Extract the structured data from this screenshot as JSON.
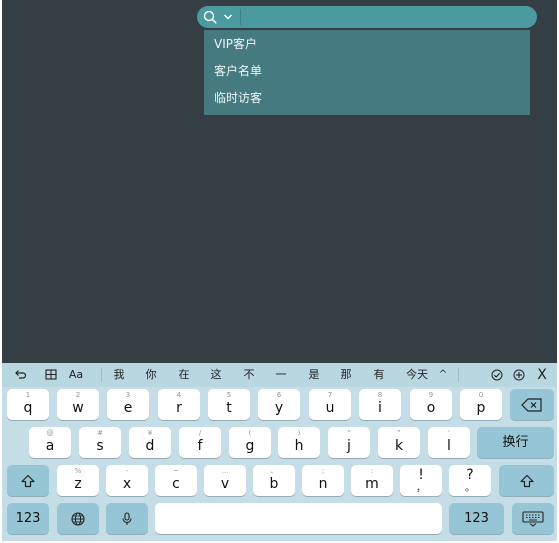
{
  "search": {
    "placeholder": "",
    "value": ""
  },
  "icons": {
    "search": "search-icon",
    "dropdown": "chevron-down-icon",
    "shift": "shift-icon",
    "backspace": "backspace-icon",
    "globe": "globe-icon",
    "mic": "microphone-icon",
    "keyboard_hide": "keyboard-hide-icon",
    "undo": "undo-icon",
    "table": "table-icon",
    "check": "check-circle-icon",
    "plus": "plus-circle-icon"
  },
  "dropdown": {
    "items": [
      "VIP客户",
      "客户名单",
      "临时访客"
    ]
  },
  "keyboard": {
    "toolbar": {
      "font_label": "Aa",
      "collapse": "^",
      "close": "X"
    },
    "candidates": [
      "我",
      "你",
      "在",
      "这",
      "不",
      "一",
      "是",
      "那",
      "有",
      "今天"
    ],
    "row1": [
      {
        "main": "q",
        "sub": "1"
      },
      {
        "main": "w",
        "sub": "2"
      },
      {
        "main": "e",
        "sub": "3"
      },
      {
        "main": "r",
        "sub": "4"
      },
      {
        "main": "t",
        "sub": "5"
      },
      {
        "main": "y",
        "sub": "6"
      },
      {
        "main": "u",
        "sub": "7"
      },
      {
        "main": "i",
        "sub": "8"
      },
      {
        "main": "o",
        "sub": "9"
      },
      {
        "main": "p",
        "sub": "0"
      }
    ],
    "row2": [
      {
        "main": "a",
        "sub": "@"
      },
      {
        "main": "s",
        "sub": "#"
      },
      {
        "main": "d",
        "sub": "¥"
      },
      {
        "main": "f",
        "sub": "/"
      },
      {
        "main": "g",
        "sub": "("
      },
      {
        "main": "h",
        "sub": ")"
      },
      {
        "main": "j",
        "sub": "“"
      },
      {
        "main": "k",
        "sub": "”"
      },
      {
        "main": "l",
        "sub": "'"
      }
    ],
    "row3": [
      {
        "main": "z",
        "sub": "%"
      },
      {
        "main": "x",
        "sub": "-"
      },
      {
        "main": "c",
        "sub": "~"
      },
      {
        "main": "v",
        "sub": "…"
      },
      {
        "main": "b",
        "sub": "、"
      },
      {
        "main": "n",
        "sub": ";"
      },
      {
        "main": "m",
        "sub": ":"
      },
      {
        "main": "!",
        "sub": "，"
      },
      {
        "main": "?",
        "sub": "。"
      }
    ],
    "enter_label": "换行",
    "numbers_label": "123",
    "space_label": ""
  },
  "colors": {
    "background": "#343e43",
    "accent": "#4a9aa0",
    "dropdown": "#447a80",
    "keyboard": "#c4dde6",
    "function_key": "#96c6d6"
  }
}
